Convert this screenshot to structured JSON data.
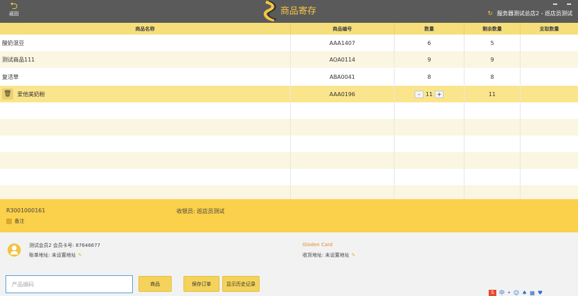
{
  "header": {
    "back_label": "返回",
    "title": "商品寄存",
    "store": "服务器测试总店2 - 巡店员测试"
  },
  "table": {
    "columns": [
      "商品名称",
      "商品编号",
      "数量",
      "剩余数量",
      "支取数量"
    ],
    "rows": [
      {
        "name": "酸奶混豆",
        "code": "AAA1407",
        "qty": "6",
        "remain": "5",
        "take": ""
      },
      {
        "name": "测试商品111",
        "code": "AOA0114",
        "qty": "9",
        "remain": "9",
        "take": ""
      },
      {
        "name": "复活草",
        "code": "ABA0041",
        "qty": "8",
        "remain": "8",
        "take": ""
      },
      {
        "name": "爱他美奶粉",
        "code": "AAA0196",
        "qty": "11",
        "remain": "11",
        "take": "",
        "minus": "-",
        "plus": "+"
      }
    ]
  },
  "info": {
    "order_no": "R3001000161",
    "cashier": "收银员: 巡店员测试",
    "note": "备注"
  },
  "member": {
    "line1": "测试会员2 会员卡号: 87646677",
    "bill_addr": "账单地址: 未设置地址",
    "card": "Gloden Card",
    "ship_addr": "收货地址: 未设置地址"
  },
  "actions": {
    "input_placeholder": "产品编码",
    "product": "商品",
    "save": "保存订单",
    "history": "显示历史记录"
  },
  "tray": {
    "ime": "S",
    "zh": "中"
  }
}
